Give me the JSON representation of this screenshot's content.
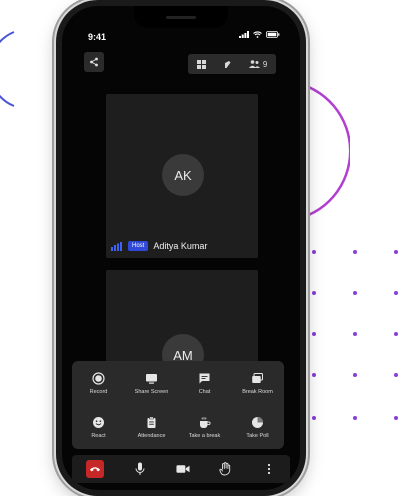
{
  "status_bar": {
    "time": "9:41"
  },
  "header": {
    "participant_count": "9"
  },
  "participants": [
    {
      "initials": "AK",
      "name": "Aditya Kumar",
      "role_badge": "Host"
    },
    {
      "initials": "AM"
    }
  ],
  "actions": [
    {
      "label": "Record",
      "icon": "record-icon"
    },
    {
      "label": "Share Screen",
      "icon": "screen-icon"
    },
    {
      "label": "Chat",
      "icon": "chat-icon"
    },
    {
      "label": "Break Room",
      "icon": "break-room-icon"
    },
    {
      "label": "React",
      "icon": "smiley-icon"
    },
    {
      "label": "Attendance",
      "icon": "clipboard-icon"
    },
    {
      "label": "Take a break",
      "icon": "coffee-icon"
    },
    {
      "label": "Take Poll",
      "icon": "pie-chart-icon"
    }
  ],
  "colors": {
    "end_call": "#c62828",
    "host_badge": "#3149d9",
    "decoration_accent": "#8a3fd8"
  }
}
